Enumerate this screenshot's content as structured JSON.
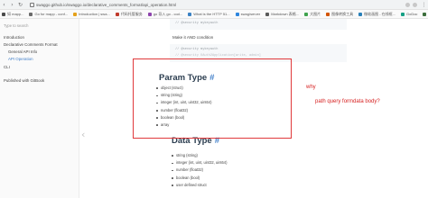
{
  "browser": {
    "url": "swaggo.github.io/swaggo.io/declarative_comments_format/api_operation.html",
    "bookmarks": [
      {
        "label": "如 mapp...",
        "color": "#4a4a4a"
      },
      {
        "label": "Go for mapp - conf...",
        "color": "#6b6b6b"
      },
      {
        "label": "Introduction | swa...",
        "color": "#e4a11b"
      },
      {
        "label": "代码托管服务",
        "color": "#c0392b"
      },
      {
        "label": "go 导入 go - cod...",
        "color": "#8e44ad"
      },
      {
        "label": "What is the HTTP 51...",
        "color": "#3b82c4"
      },
      {
        "label": "swag/server",
        "color": "#2e86de"
      },
      {
        "label": "Markdown 表格...",
        "color": "#5a5a5a"
      },
      {
        "label": "大图片",
        "color": "#3fa34d"
      },
      {
        "label": "图像转换工具",
        "color": "#d35400"
      },
      {
        "label": "微软画图 - 在线框...",
        "color": "#2980b9"
      },
      {
        "label": "GoDoc",
        "color": "#16a085"
      },
      {
        "label": "GoSwag | Swagger...",
        "color": "#3c6e3c"
      },
      {
        "label": "... | GoFr...",
        "color": "#7f8c8d"
      }
    ]
  },
  "sidebar": {
    "search_placeholder": "Type to search",
    "items": [
      {
        "label": "Introduction"
      },
      {
        "label": "Declarative Comments Format"
      },
      {
        "label": "General API Info"
      },
      {
        "label": "API Operation"
      },
      {
        "label": "CLI"
      },
      {
        "label": "Published with GitBook"
      }
    ]
  },
  "content": {
    "code_top": {
      "line1": "// @security mykeyauth"
    },
    "make_it_and": "Make it AND condition",
    "code_mid": {
      "line1": "// @security mykeyauth",
      "line2": "// @security OAuth2Application[write, admin]"
    },
    "param_type": {
      "title": "Param Type",
      "hash": "#",
      "items": [
        "object (struct)",
        "string (string)",
        "integer (int, uint, uint32, uint64)",
        "number (float32)",
        "boolean (bool)",
        "array"
      ]
    },
    "data_type": {
      "title": "Data Type",
      "hash": "#",
      "items": [
        "string (string)",
        "integer (int, uint, uint32, uint64)",
        "number (float32)",
        "boolean (bool)",
        "user defined struct"
      ]
    }
  },
  "annotation": {
    "why": "why",
    "question": "path query formdata body?",
    "color": "#e0393b"
  }
}
